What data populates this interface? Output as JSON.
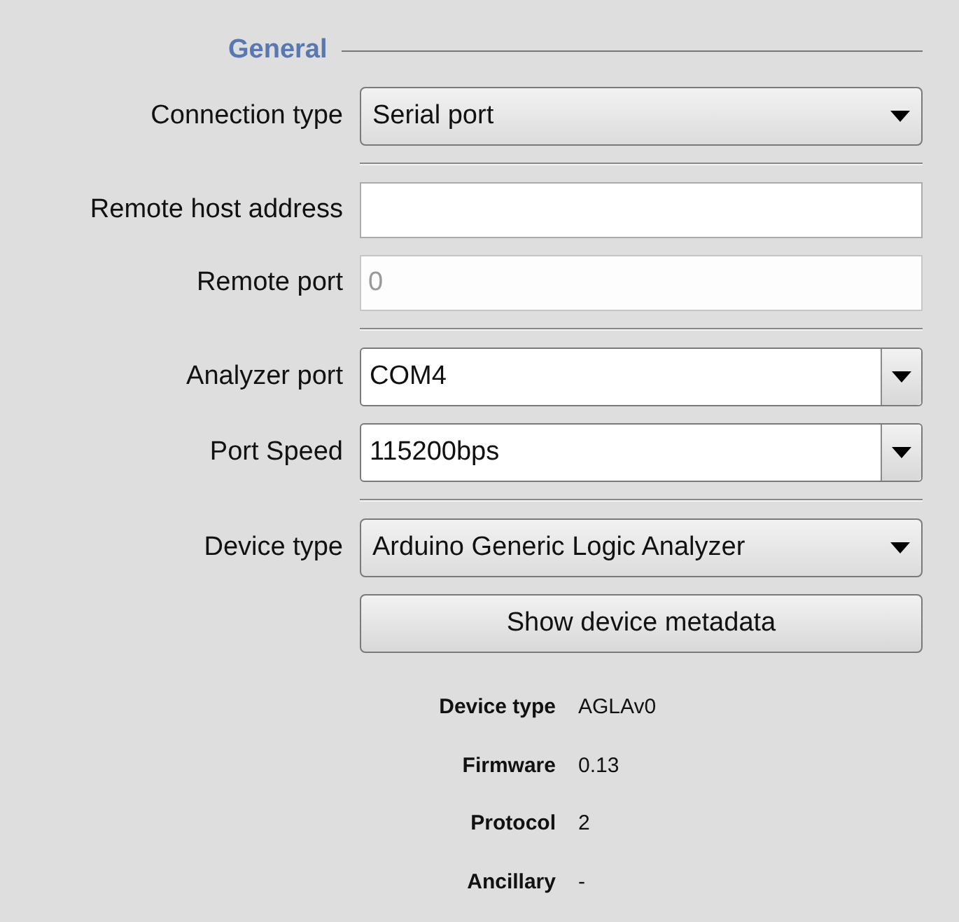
{
  "section": {
    "title": "General"
  },
  "rows": [
    {
      "kind": "combo",
      "label": "Connection type",
      "value": "Serial port"
    },
    {
      "kind": "separator"
    },
    {
      "kind": "field",
      "label": "Remote host address",
      "disabled": false
    },
    {
      "kind": "field",
      "label": "Remote port",
      "value": "0",
      "disabled": true
    },
    {
      "kind": "separator"
    },
    {
      "kind": "editable_combo",
      "label": "Analyzer port",
      "value": "COM4"
    },
    {
      "kind": "editable_combo",
      "label": "Port Speed",
      "value": "115200bps"
    },
    {
      "kind": "separator"
    },
    {
      "kind": "combo",
      "label": "Device type",
      "value": "Arduino Generic Logic Analyzer"
    },
    {
      "kind": "button",
      "label": "Show device metadata"
    }
  ],
  "metadata": [
    {
      "label": "Device type",
      "value": "AGLAv0"
    },
    {
      "label": "Firmware",
      "value": "0.13"
    },
    {
      "label": "Protocol",
      "value": "2"
    },
    {
      "label": "Ancillary",
      "value": "-"
    }
  ]
}
